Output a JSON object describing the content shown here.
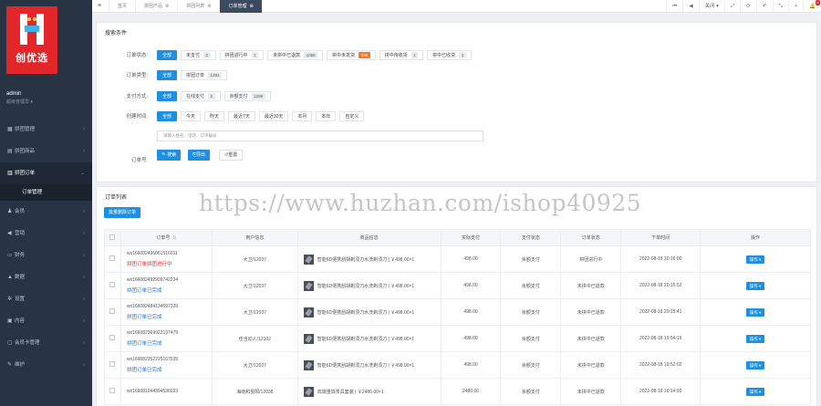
{
  "logo": {
    "text": "创优选"
  },
  "user": {
    "name": "admin",
    "role": "超级管理员 ▾"
  },
  "sidebar": {
    "items": [
      {
        "label": "拼团管理",
        "icon": "▦"
      },
      {
        "label": "拼团商品",
        "icon": "▤"
      },
      {
        "label": "拼团订单",
        "icon": "▥",
        "active": true
      },
      {
        "label": "会员",
        "icon": "♟"
      },
      {
        "label": "营销",
        "icon": "◀"
      },
      {
        "label": "财务",
        "icon": "▭"
      },
      {
        "label": "数据",
        "icon": "▲"
      },
      {
        "label": "设置",
        "icon": "✲"
      },
      {
        "label": "内容",
        "icon": "▣"
      },
      {
        "label": "会员卡管理",
        "icon": "▢"
      },
      {
        "label": "维护",
        "icon": "✎"
      }
    ],
    "sub_item": "订单管理"
  },
  "topbar": {
    "tabs": [
      {
        "label": "首页"
      },
      {
        "label": "拼团产品",
        "close": "⊗"
      },
      {
        "label": "拼团列表",
        "close": "⊗"
      },
      {
        "label": "订单管理",
        "close": "⊗",
        "active": true
      }
    ],
    "tools": {
      "first": "⏮",
      "prev": "◀",
      "close_menu": "关闭 ▾",
      "full": "⤢",
      "refresh": "⟳",
      "back": "↶",
      "expand": "⤡",
      "add": "+",
      "notify": "🔔",
      "notify_count": "6"
    }
  },
  "search": {
    "title": "搜索条件",
    "rows": [
      {
        "label": "订单状态:",
        "options": [
          {
            "text": "全部",
            "selected": true
          },
          {
            "text": "未支付",
            "count": "2"
          },
          {
            "text": "拼团进行中",
            "count": "1"
          },
          {
            "text": "未拼中已退款",
            "count": "1058"
          },
          {
            "text": "拼中未发货",
            "count": "230",
            "hot": true
          },
          {
            "text": "拼中待收货",
            "count": "1"
          },
          {
            "text": "拼中已收货",
            "count": "1"
          }
        ]
      },
      {
        "label": "订单类型:",
        "options": [
          {
            "text": "全部",
            "selected": true
          },
          {
            "text": "拼团订单",
            "count": "1291"
          }
        ]
      },
      {
        "label": "支付方式:",
        "options": [
          {
            "text": "全部",
            "selected": true
          },
          {
            "text": "在线支付",
            "count": "2"
          },
          {
            "text": "余额支付",
            "count": "1289"
          }
        ]
      },
      {
        "label": "创建时间:",
        "options": [
          {
            "text": "全部",
            "selected": true
          },
          {
            "text": "今天"
          },
          {
            "text": "昨天"
          },
          {
            "text": "最近7天"
          },
          {
            "text": "最近30天"
          },
          {
            "text": "本月"
          },
          {
            "text": "本年"
          },
          {
            "text": "自定义"
          }
        ]
      }
    ],
    "order_no_label": "订单号:",
    "order_no_placeholder": "请输入姓名、电话、订单编号",
    "search_btn": "🔍搜索",
    "export_btn": "⎘导出",
    "reset_btn": "↺重置"
  },
  "list": {
    "title": "订单列表",
    "batch_delete": "批量删除订单",
    "columns": [
      "订单号",
      "用户信息",
      "商品信息",
      "实际支付",
      "支付状态",
      "订单状态",
      "下单时间",
      "操作"
    ],
    "rows": [
      {
        "no": "wx166082496061516011",
        "link": "拼团订单拼团进行中",
        "link_red": true,
        "user": "大卫/12037",
        "product": "智能6D便携刮胡剃须刀水洗剃须刀 | ￥498.00×1",
        "pay": "498.00",
        "pay_status": "余额支付",
        "status": "拼团进行中",
        "time": "2022-08-18 20:16:00",
        "op": "操作 ▾"
      },
      {
        "no": "wx166082492909742234",
        "link": "拼团订单已完成",
        "user": "大卫/12037",
        "product": "智能6D便携刮胡剃须刀水洗剃须刀 | ￥498.00×1",
        "pay": "498.00",
        "pay_status": "余额支付",
        "status": "未拼中已退款",
        "time": "2022-08-18 20:15:52",
        "op": "操作 ▾"
      },
      {
        "no": "wx166082484134697339",
        "link": "拼团订单已完成",
        "user": "大卫/12037",
        "product": "智能6D便携刮胡剃须刀水洗剃须刀 | ￥498.00×1",
        "pay": "498.00",
        "pay_status": "余额支付",
        "status": "未拼中已退款",
        "time": "2022-08-18 20:15:41",
        "op": "操作 ▾"
      },
      {
        "no": "wx166082369922137479",
        "link": "拼团订单已完成",
        "user": "佳当动人/12102",
        "product": "智能6D便携刮胡剃须刀水洗剃须刀 | ￥498.00×1",
        "pay": "498.00",
        "pay_status": "余额支付",
        "status": "未拼中已退款",
        "time": "2022-08-18 19:54:19",
        "op": "操作 ▾"
      },
      {
        "no": "wx166082352225167535",
        "link": "拼团订单已完成",
        "user": "大卫/12037",
        "product": "智能6D便携刮胡剃须刀水洗剃须刀 | ￥498.00×1",
        "pay": "498.00",
        "pay_status": "余额支付",
        "status": "未拼中已退款",
        "time": "2022-08-18 19:52:02",
        "op": "操作 ▾"
      },
      {
        "no": "wx166081044394536033",
        "link": "",
        "user": "海南和悦阳/12038",
        "product": "高端重铁茶具套装 | ￥2480.00×1",
        "pay": "2480.00",
        "pay_status": "余额支付",
        "status": "未拼中已退款",
        "time": "2022-08-18 16:14:03",
        "op": "操作 ▾"
      }
    ]
  },
  "watermark": "https://www.huzhan.com/ishop40925"
}
